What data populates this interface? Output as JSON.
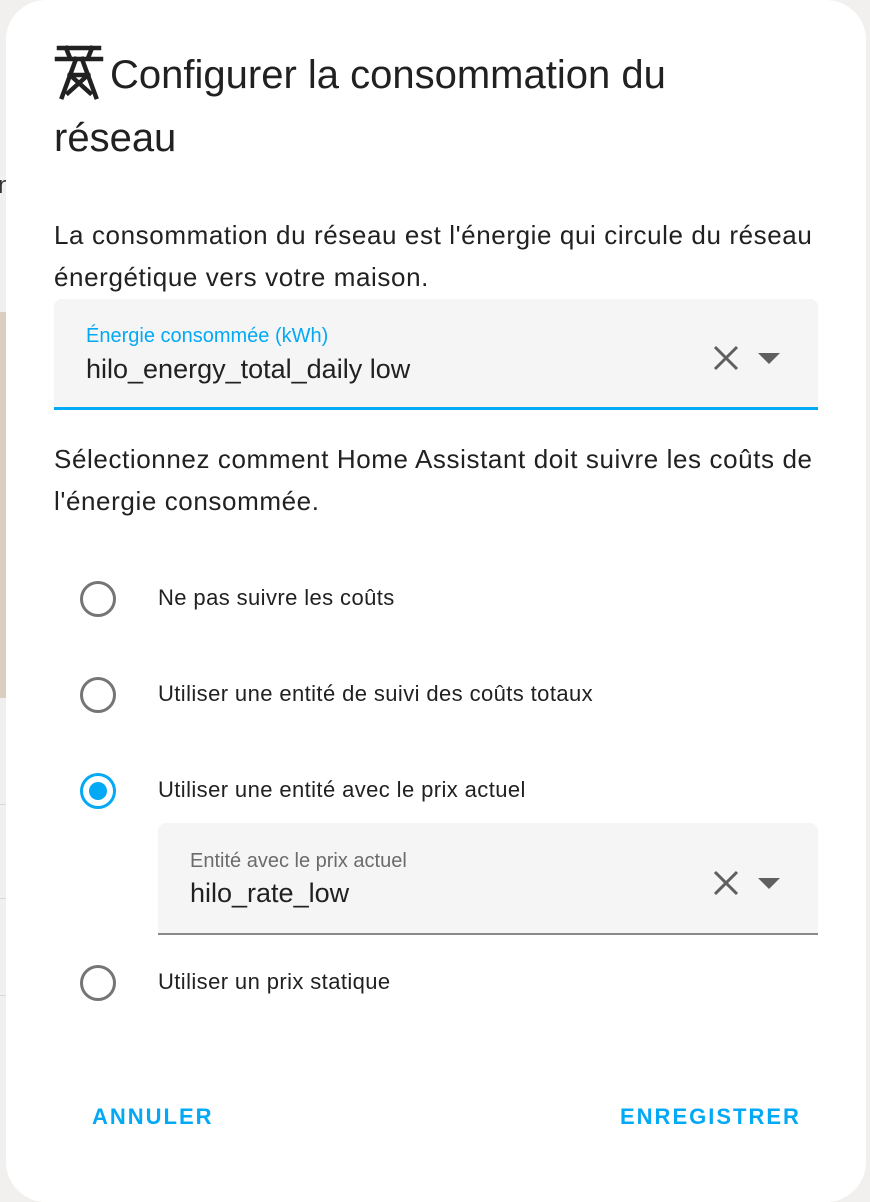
{
  "dialog": {
    "title": "Configurer la consommation du réseau",
    "title_icon": "transmission-tower-icon",
    "intro": "La consommation du réseau est l'énergie qui circule du réseau énergétique vers votre maison.",
    "energy_field": {
      "label": "Énergie consommée (kWh)",
      "value": "hilo_energy_total_daily low"
    },
    "cost_prompt": "Sélectionnez comment Home Assistant doit suivre les coûts de l'énergie consommée.",
    "cost_options": [
      {
        "label": "Ne pas suivre les coûts",
        "selected": false
      },
      {
        "label": "Utiliser une entité de suivi des coûts totaux",
        "selected": false
      },
      {
        "label": "Utiliser une entité avec le prix actuel",
        "selected": true
      },
      {
        "label": "Utiliser un prix statique",
        "selected": false
      }
    ],
    "price_field": {
      "label": "Entité avec le prix actuel",
      "value": "hilo_rate_low"
    },
    "cancel_label": "ANNULER",
    "save_label": "ENREGISTRER"
  },
  "colors": {
    "accent": "#03a9f4",
    "field_background": "#f5f5f5",
    "text": "#212121",
    "muted": "#757575"
  },
  "background": {
    "partial_text": "n"
  }
}
